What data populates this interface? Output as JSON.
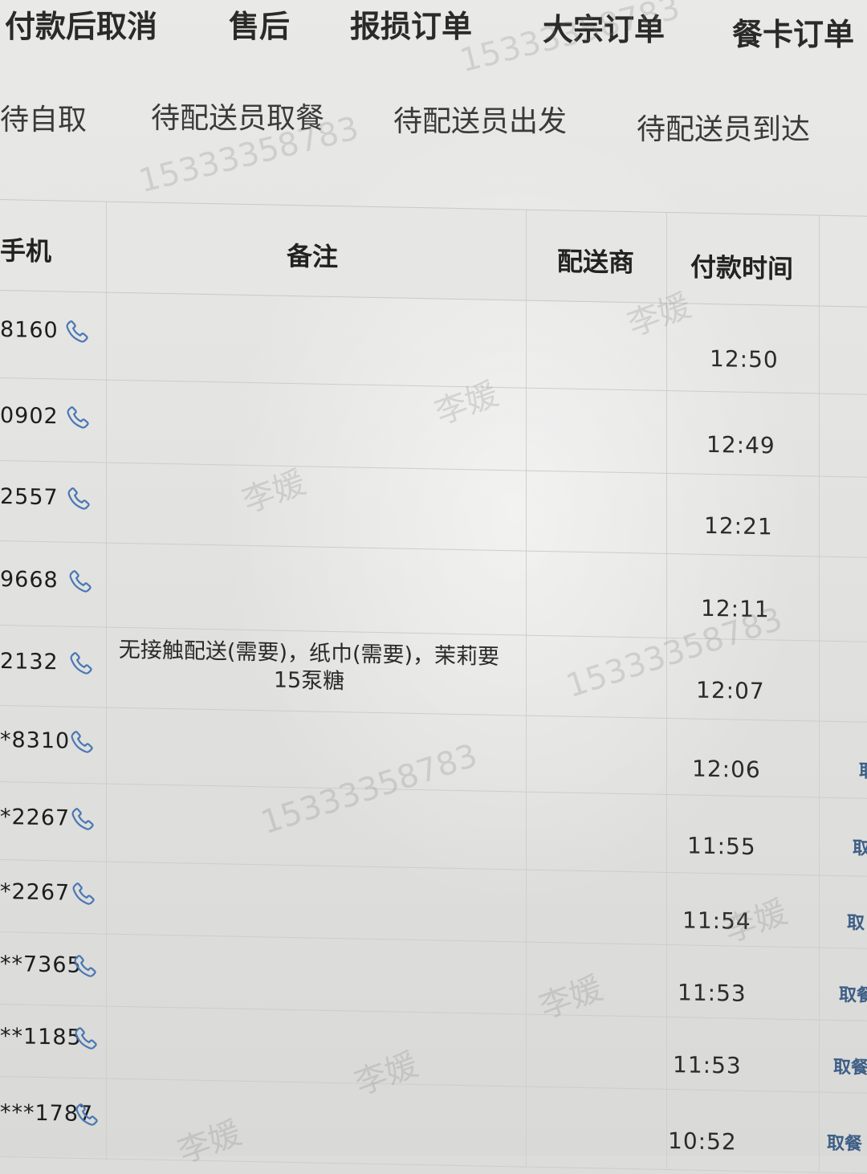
{
  "top_tabs": [
    {
      "label": "付款后取消"
    },
    {
      "label": "售后"
    },
    {
      "label": "报损订单"
    },
    {
      "label": "大宗订单"
    },
    {
      "label": "餐卡订单"
    }
  ],
  "sub_tabs": [
    {
      "label": "待自取"
    },
    {
      "label": "待配送员取餐"
    },
    {
      "label": "待配送员出发"
    },
    {
      "label": "待配送员到达"
    }
  ],
  "table": {
    "headers": {
      "phone": "手机",
      "note": "备注",
      "courier": "配送商",
      "paid_time": "付款时间"
    },
    "rows": [
      {
        "phone": "8160",
        "note": "",
        "time": "12:50",
        "action": ""
      },
      {
        "phone": "0902",
        "note": "",
        "time": "12:49",
        "action": ""
      },
      {
        "phone": "2557",
        "note": "",
        "time": "12:21",
        "action": ""
      },
      {
        "phone": "9668",
        "note": "",
        "time": "12:11",
        "action": ""
      },
      {
        "phone": "2132",
        "note": "无接触配送(需要)，纸巾(需要)，茉莉要15泵糖",
        "time": "12:07",
        "action": ""
      },
      {
        "phone": "*8310",
        "note": "",
        "time": "12:06",
        "action": "取"
      },
      {
        "phone": "*2267",
        "note": "",
        "time": "11:55",
        "action": "取"
      },
      {
        "phone": "*2267",
        "note": "",
        "time": "11:54",
        "action": "取"
      },
      {
        "phone": "**7365",
        "note": "",
        "time": "11:53",
        "action": "取餐"
      },
      {
        "phone": "**1185",
        "note": "",
        "time": "11:53",
        "action": "取餐"
      },
      {
        "phone": "***1787",
        "note": "",
        "time": "10:52",
        "action": "取餐"
      }
    ]
  },
  "watermarks": {
    "name": "李媛",
    "number": "15333358783"
  },
  "colors": {
    "phone_icon": "#4a78b5",
    "action_text": "#3d5e86"
  },
  "icons": {
    "phone": "phone-icon"
  }
}
